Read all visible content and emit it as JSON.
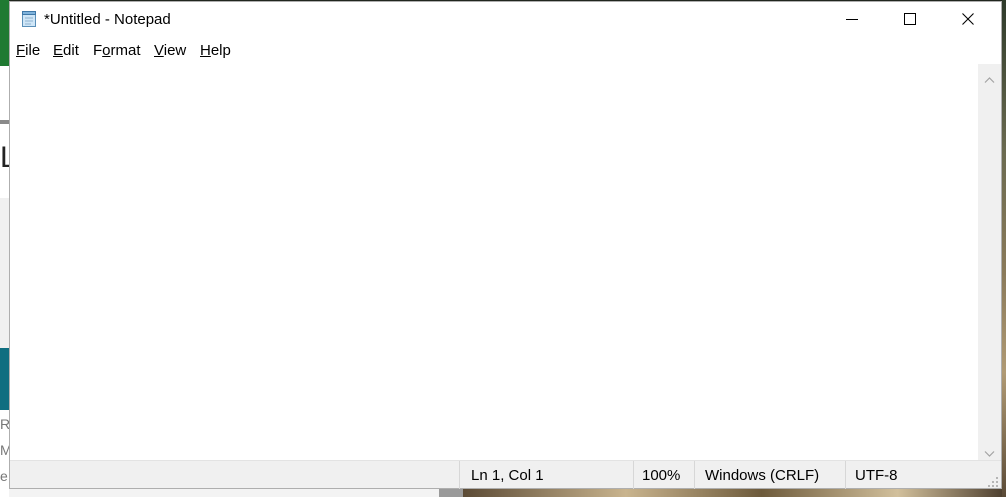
{
  "window": {
    "title": "*Untitled - Notepad"
  },
  "caption_buttons": {
    "minimize_icon": "minimize-icon",
    "maximize_icon": "maximize-icon",
    "close_icon": "close-icon"
  },
  "menu": {
    "items": [
      {
        "mnemonic": "F",
        "rest": "ile"
      },
      {
        "mnemonic": "E",
        "rest": "dit"
      },
      {
        "pre": "F",
        "mnemonic": "o",
        "rest": "rmat"
      },
      {
        "mnemonic": "V",
        "rest": "iew"
      },
      {
        "mnemonic": "H",
        "rest": "elp"
      }
    ]
  },
  "editor": {
    "content": ""
  },
  "statusbar": {
    "position": "Ln 1, Col 1",
    "zoom": "100%",
    "line_ending": "Windows (CRLF)",
    "encoding": "UTF-8"
  },
  "background": {
    "left_letter": "L",
    "left_fragments": [
      "R",
      "Mi",
      "e"
    ]
  },
  "colors": {
    "window_bg": "#ffffff",
    "chrome_bg": "#f0f0f0",
    "taskbar_green": "#1f7a32",
    "teal": "#0f6e80"
  }
}
